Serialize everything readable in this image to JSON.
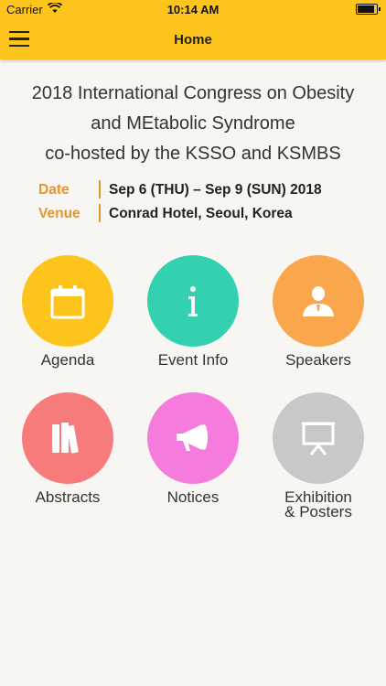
{
  "status": {
    "carrier": "Carrier",
    "time": "10:14 AM",
    "battery_level": 1.0
  },
  "navbar": {
    "title": "Home",
    "menu_icon": "hamburger-menu-icon"
  },
  "header": {
    "line1": "2018 International Congress on Obesity",
    "line2": "and MEtabolic Syndrome",
    "line3": "co-hosted by the KSSO and KSMBS"
  },
  "info": {
    "date_label": "Date",
    "date_value": "Sep 6 (THU) – Sep 9 (SUN) 2018",
    "venue_label": "Venue",
    "venue_value": "Conrad Hotel, Seoul, Korea"
  },
  "menu": [
    {
      "label": "Agenda",
      "icon": "calendar-icon",
      "color": "#fdc51c"
    },
    {
      "label": "Event Info",
      "icon": "info-icon",
      "color": "#33d1b0"
    },
    {
      "label": "Speakers",
      "icon": "speaker-person-icon",
      "color": "#f9a64c"
    },
    {
      "label": "Abstracts",
      "icon": "books-icon",
      "color": "#f77b7b"
    },
    {
      "label": "Notices",
      "icon": "megaphone-icon",
      "color": "#f57bdd"
    },
    {
      "label": "Exhibition\n& Posters",
      "label_line1": "Exhibition",
      "label_line2": "& Posters",
      "icon": "presentation-board-icon",
      "color": "#c8c8c8"
    }
  ],
  "colors": {
    "brand_yellow": "#fdc51c",
    "accent_orange": "#e5952a",
    "background": "#f7f6f2"
  }
}
